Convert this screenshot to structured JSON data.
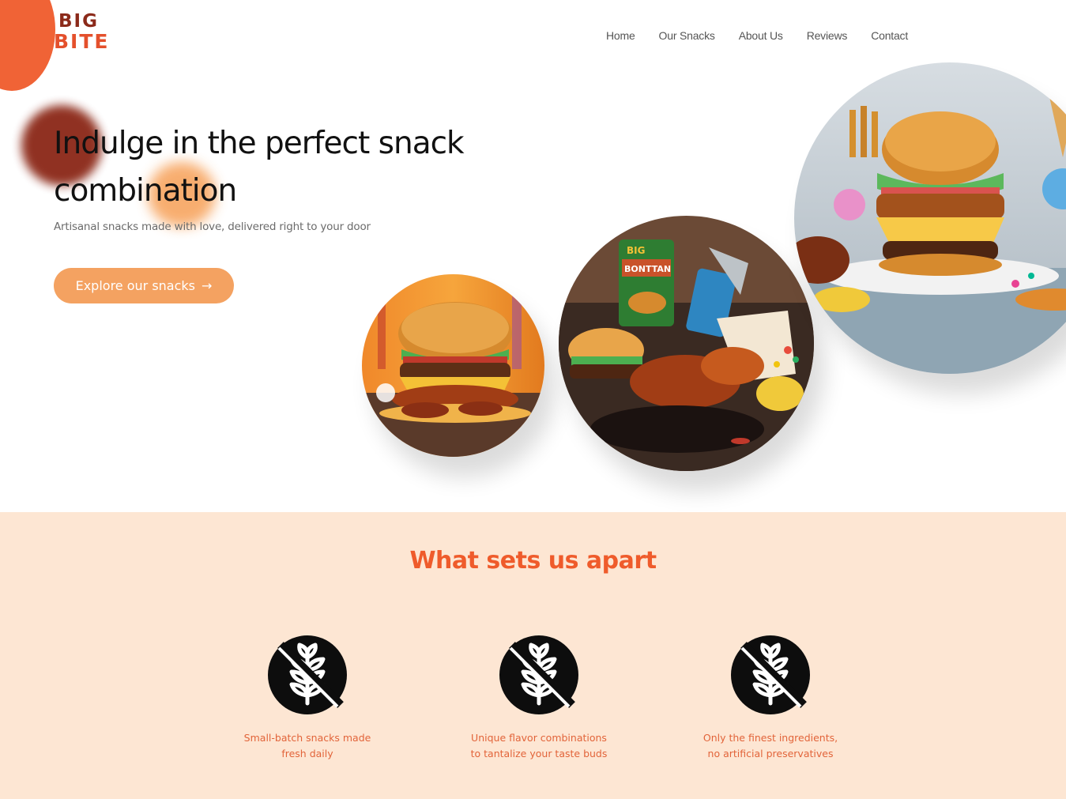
{
  "brand": {
    "logo_line1": "BIG",
    "logo_line2": "BITE"
  },
  "nav": {
    "items": [
      "Home",
      "Our Snacks",
      "About Us",
      "Reviews",
      "Contact"
    ]
  },
  "hero": {
    "title": "Indulge in the perfect snack combination",
    "subtitle": "Artisanal snacks made with love, delivered right to your door",
    "cta_label": "Explore our snacks",
    "cta_icon": "arrow-right-icon"
  },
  "photos": {
    "icons": [
      "burger-photo",
      "snack-spread-photo",
      "burger-platter-photo"
    ],
    "bag_text_1": "BIG",
    "bag_text_2": "BONTTAN"
  },
  "features": {
    "title": "What sets us apart",
    "items": [
      {
        "icon": "no-gluten-icon",
        "text": "Small-batch snacks made fresh daily"
      },
      {
        "icon": "no-gluten-icon",
        "text": "Unique flavor combinations to tantalize your taste buds"
      },
      {
        "icon": "no-gluten-icon",
        "text": "Only the finest ingredients, no artificial preservatives"
      }
    ]
  },
  "colors": {
    "accent_orange": "#f4a261",
    "title_orange": "#ef5b2b",
    "features_bg": "#fde6d3",
    "logo_dark": "#8b2a1a",
    "logo_light": "#e4502c"
  }
}
